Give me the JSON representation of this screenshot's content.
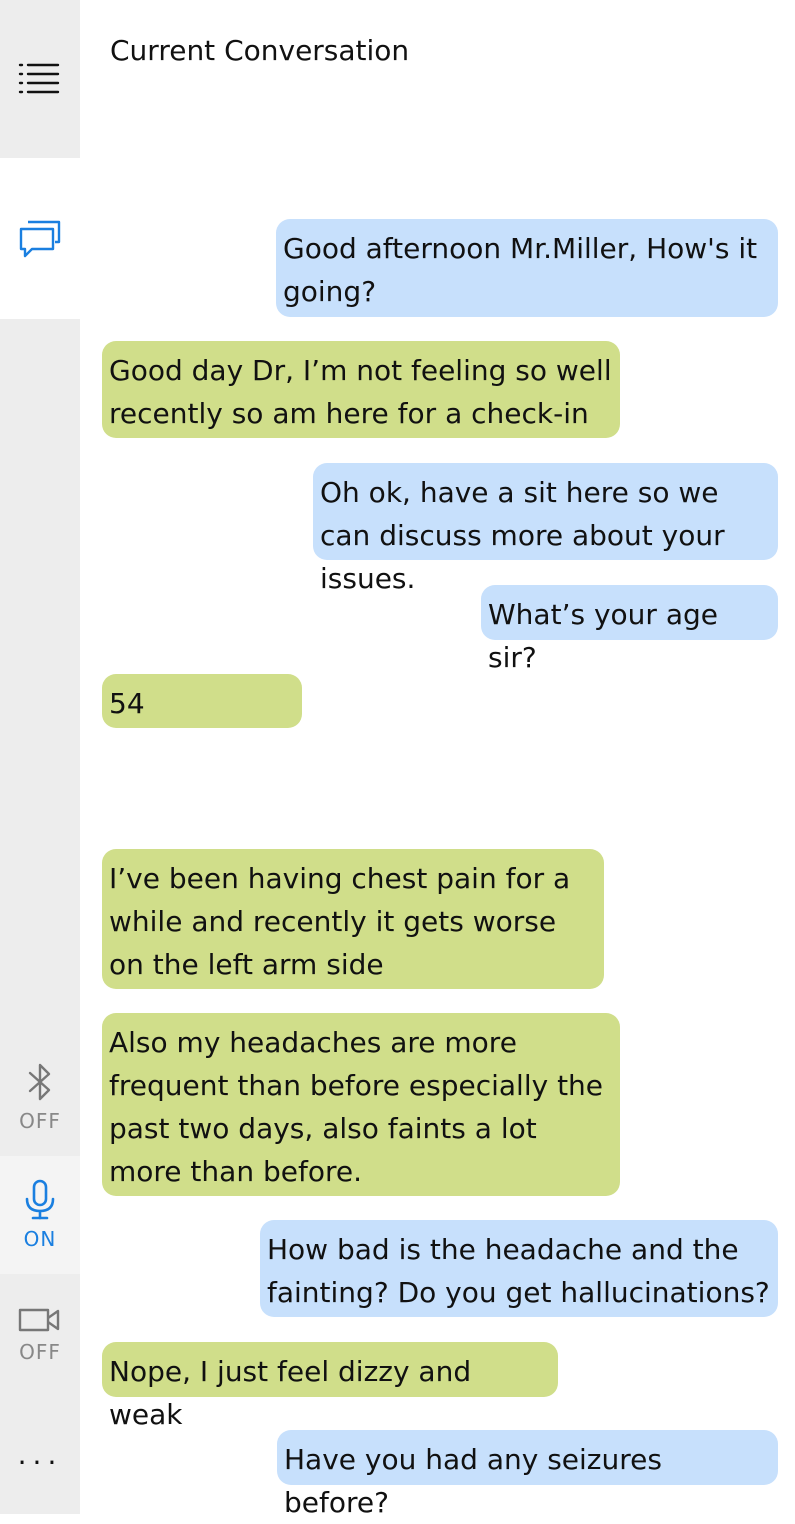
{
  "header": {
    "title": "Current Conversation"
  },
  "sidebar": {
    "bluetooth_label": "OFF",
    "mic_label": "ON",
    "camera_label": "OFF",
    "more_label": "...",
    "accent_color": "#1a7fe0"
  },
  "messages": [
    {
      "speaker": "doctor",
      "text": "Good afternoon Mr.Miller, How's it going?"
    },
    {
      "speaker": "patient",
      "text": "Good day Dr, I’m not feeling so well recently so am here for a check-in"
    },
    {
      "speaker": "doctor",
      "text": "Oh ok, have a sit here so we can discuss more about your issues."
    },
    {
      "speaker": "doctor",
      "text": "What’s your age sir?"
    },
    {
      "speaker": "patient",
      "text": "54"
    },
    {
      "speaker": "patient",
      "text": "I’ve been having chest pain for a while and recently it gets worse on the left arm side"
    },
    {
      "speaker": "patient",
      "text": "Also my headaches are more frequent than before especially the past two days, also faints a lot more than before."
    },
    {
      "speaker": "doctor",
      "text": "How bad is the headache and the fainting? Do you get hallucinations?"
    },
    {
      "speaker": "patient",
      "text": "Nope, I just feel dizzy and weak"
    },
    {
      "speaker": "doctor",
      "text": "Have you had any seizures before?"
    }
  ]
}
